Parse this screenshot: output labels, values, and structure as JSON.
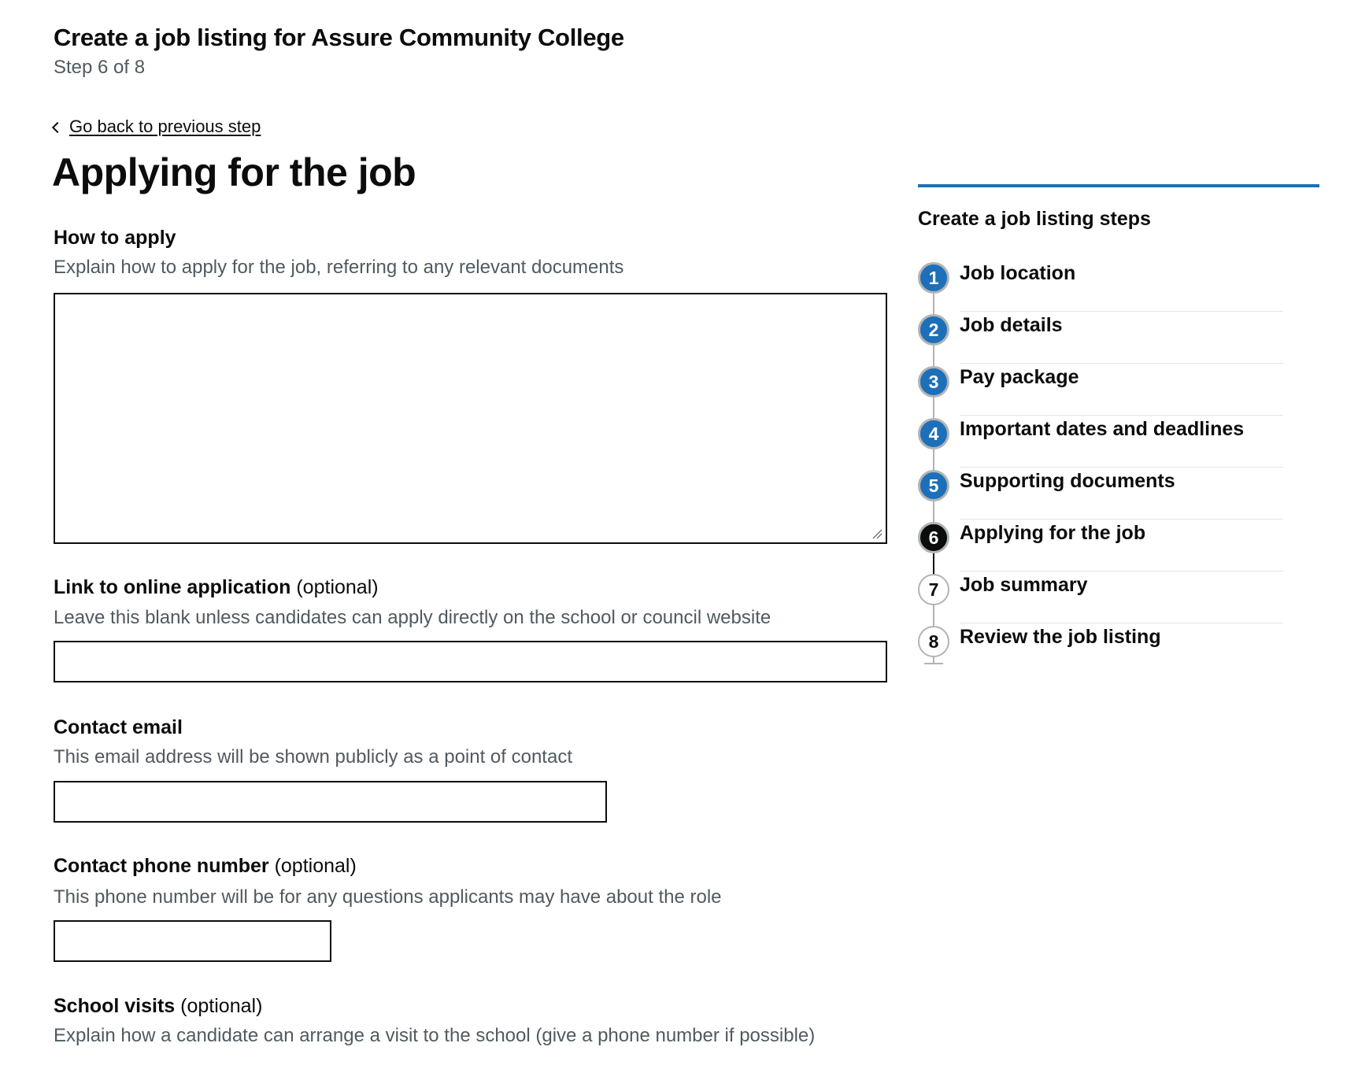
{
  "header": {
    "title": "Create a job listing for Assure Community College",
    "step_indicator": "Step 6 of 8"
  },
  "back_link": "Go back to previous step",
  "page_title": "Applying for the job",
  "fields": {
    "how_to_apply": {
      "label": "How to apply",
      "hint": "Explain how to apply for the job, referring to any relevant documents",
      "value": ""
    },
    "application_link": {
      "label": "Link to online application",
      "optional": "(optional)",
      "hint": "Leave this blank unless candidates can apply directly on the school or council website",
      "value": ""
    },
    "contact_email": {
      "label": "Contact email",
      "hint": "This email address will be shown publicly as a point of contact",
      "value": ""
    },
    "contact_phone": {
      "label": "Contact phone number",
      "optional": "(optional)",
      "hint": "This phone number will be for any questions applicants may have about the role",
      "value": ""
    },
    "school_visits": {
      "label": "School visits",
      "optional": "(optional)",
      "hint": "Explain how a candidate can arrange a visit to the school (give a phone number if possible)"
    }
  },
  "sidebar": {
    "heading": "Create a job listing steps",
    "accent_color": "#1d70b8",
    "current_step": 6,
    "steps": [
      {
        "number": "1",
        "label": "Job location",
        "status": "done"
      },
      {
        "number": "2",
        "label": "Job details",
        "status": "done"
      },
      {
        "number": "3",
        "label": "Pay package",
        "status": "done"
      },
      {
        "number": "4",
        "label": "Important dates and deadlines",
        "status": "done"
      },
      {
        "number": "5",
        "label": "Supporting documents",
        "status": "done"
      },
      {
        "number": "6",
        "label": "Applying for the job",
        "status": "current"
      },
      {
        "number": "7",
        "label": "Job summary",
        "status": "todo"
      },
      {
        "number": "8",
        "label": "Review the job listing",
        "status": "todo"
      }
    ]
  }
}
